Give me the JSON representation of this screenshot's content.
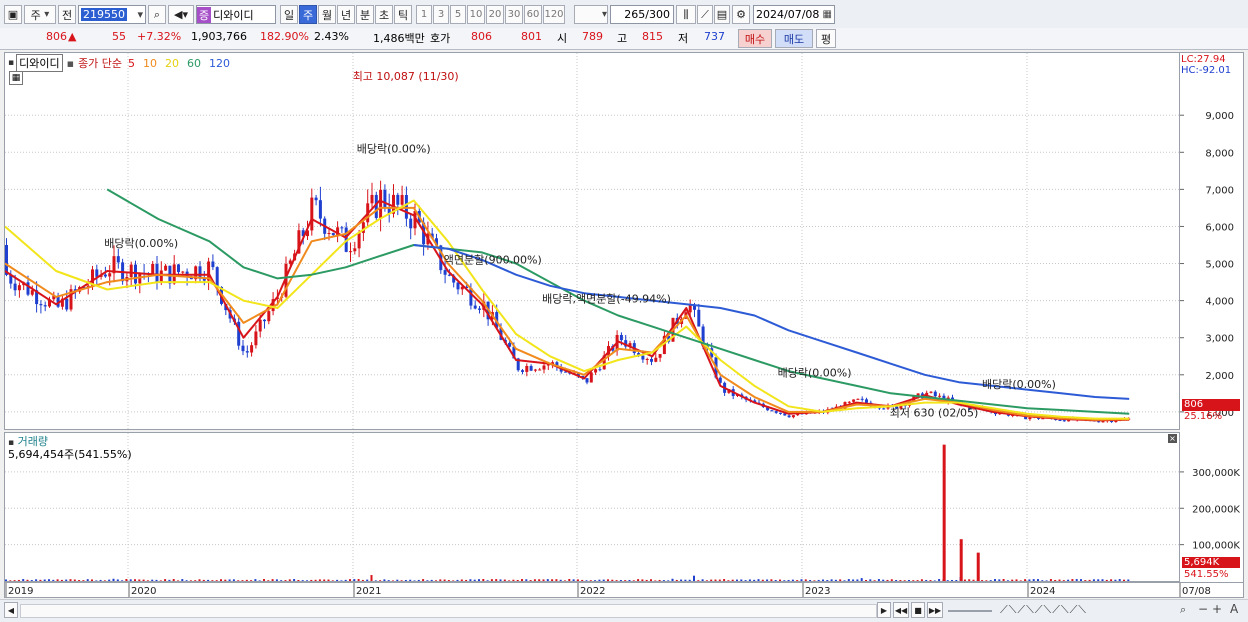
{
  "toolbar": {
    "market_label": "주",
    "prev_label": "전",
    "code": "219550",
    "stock_badge": "증",
    "stock_name": "디와이디",
    "periods": [
      "일",
      "주",
      "월",
      "년",
      "분",
      "초",
      "틱"
    ],
    "selected_period": "주",
    "intervals": [
      "1",
      "3",
      "5",
      "10",
      "20",
      "30",
      "60",
      "120"
    ],
    "count": "265",
    "count_max": "/300",
    "date": "2024/07/08"
  },
  "quote": {
    "price": "806",
    "change": "55",
    "change_pct": "+7.32%",
    "volume": "1,903,766",
    "volume_ratio": "182.90%",
    "turnover": "2.43%",
    "amount": "1,486백만",
    "bid_label": "호가",
    "bid": "806",
    "ask": "801",
    "open_label": "시",
    "open": "789",
    "high_label": "고",
    "high": "815",
    "low_label": "저",
    "low": "737",
    "buy_label": "매수",
    "sell_label": "매도",
    "eval_label": "평"
  },
  "price_panel": {
    "name_tag": "디와이디",
    "legend_prefix": "종가 단순",
    "ma_periods": [
      "5",
      "10",
      "20",
      "60",
      "120"
    ],
    "right_lc": "LC:27.94",
    "right_hc": "HC:-92.01",
    "current_price_tag": "806",
    "current_pct_tag": "25.16%"
  },
  "volume_panel": {
    "title": "거래량",
    "value": "5,694,454주(541.55%)",
    "current_vol_tag": "5,694K",
    "current_vol_pct": "541.55%"
  },
  "annotations": [
    "최고 10,087 (11/30)",
    "배당락(0.00%)",
    "배당락(0.00%)",
    "액면분할(900.00%)",
    "배당락,액면분할(-49.94%)",
    "배당락(0.00%)",
    "배당락(0.00%)",
    "최저 630 (02/05)"
  ],
  "colors": {
    "up": "#d8141b",
    "down": "#1e3fcf",
    "ma5": "#d8141b",
    "ma10": "#f08a1c",
    "ma20": "#f2e51b",
    "ma60": "#2c9a63",
    "ma120": "#2d5bd6"
  },
  "chart_data": {
    "type": "candlestick",
    "title": "",
    "x_ticks": [
      "2019",
      "2020",
      "2021",
      "2022",
      "2023",
      "2024",
      "07/08"
    ],
    "y_ticks": [
      "1,000",
      "2,000",
      "3,000",
      "4,000",
      "5,000",
      "6,000",
      "7,000",
      "8,000",
      "9,000"
    ],
    "ylim": [
      700,
      10300
    ],
    "volume_ticks": [
      "100,000K",
      "200,000K",
      "300,000K"
    ],
    "volume_ylim": [
      0,
      385000
    ],
    "series": [
      {
        "name": "종가",
        "x": [
          "2018-11",
          "2019-01",
          "2019-04",
          "2019-07",
          "2019-10",
          "2020-01",
          "2020-03",
          "2020-05",
          "2020-07",
          "2020-09",
          "2020-11",
          "2021-01",
          "2021-03",
          "2021-05",
          "2021-07",
          "2021-09",
          "2021-11",
          "2022-01",
          "2022-03",
          "2022-05",
          "2022-07",
          "2022-09",
          "2022-11",
          "2023-01",
          "2023-03",
          "2023-05",
          "2023-07",
          "2023-09",
          "2023-11",
          "2024-01",
          "2024-03",
          "2024-05",
          "2024-07"
        ],
        "values": [
          5500,
          4700,
          3800,
          4900,
          4700,
          4900,
          2500,
          4200,
          6500,
          5500,
          6800,
          6200,
          4600,
          3900,
          2200,
          2300,
          1800,
          3000,
          2400,
          4000,
          1600,
          1200,
          900,
          1000,
          1300,
          1100,
          1500,
          1200,
          1000,
          850,
          800,
          760,
          806
        ]
      },
      {
        "name": "5",
        "values": [
          5200,
          4800,
          3900,
          4800,
          4700,
          4700,
          3000,
          4100,
          6200,
          5700,
          6700,
          6300,
          4800,
          3900,
          2400,
          2300,
          1900,
          2900,
          2500,
          3800,
          1700,
          1250,
          950,
          1000,
          1250,
          1150,
          1450,
          1200,
          1000,
          880,
          810,
          770,
          790
        ]
      },
      {
        "name": "10",
        "values": [
          6200,
          5000,
          4100,
          4500,
          4700,
          4600,
          3400,
          3900,
          5600,
          5800,
          6500,
          6500,
          5000,
          4000,
          2700,
          2300,
          2000,
          2700,
          2600,
          3600,
          2000,
          1400,
          1000,
          1000,
          1200,
          1150,
          1350,
          1250,
          1050,
          900,
          830,
          790,
          800
        ]
      },
      {
        "name": "20",
        "values": [
          7200,
          6000,
          4800,
          4300,
          4500,
          4500,
          4000,
          3800,
          4700,
          5600,
          6200,
          6700,
          5600,
          4300,
          3100,
          2500,
          2100,
          2400,
          2600,
          3300,
          2400,
          1700,
          1150,
          1000,
          1100,
          1150,
          1250,
          1250,
          1100,
          950,
          870,
          820,
          820
        ]
      },
      {
        "name": "60",
        "values": [
          null,
          null,
          null,
          7000,
          6200,
          5600,
          4900,
          4600,
          4700,
          4900,
          5200,
          5500,
          5400,
          5300,
          5000,
          4500,
          4000,
          3600,
          3300,
          3000,
          2700,
          2400,
          2100,
          1900,
          1700,
          1500,
          1400,
          1300,
          1200,
          1100,
          1050,
          1000,
          950
        ]
      },
      {
        "name": "120",
        "values": [
          null,
          null,
          null,
          null,
          null,
          null,
          null,
          null,
          null,
          null,
          null,
          5500,
          5400,
          5100,
          4700,
          4400,
          4200,
          4100,
          4000,
          3900,
          3800,
          3600,
          3200,
          2900,
          2600,
          2300,
          2000,
          1800,
          1700,
          1600,
          1500,
          1400,
          1350
        ]
      }
    ],
    "volume_spikes": [
      {
        "x": "2023-03",
        "value": 375000
      },
      {
        "x": "2023-04",
        "value": 115000
      },
      {
        "x": "2023-05",
        "value": 78000
      }
    ]
  }
}
